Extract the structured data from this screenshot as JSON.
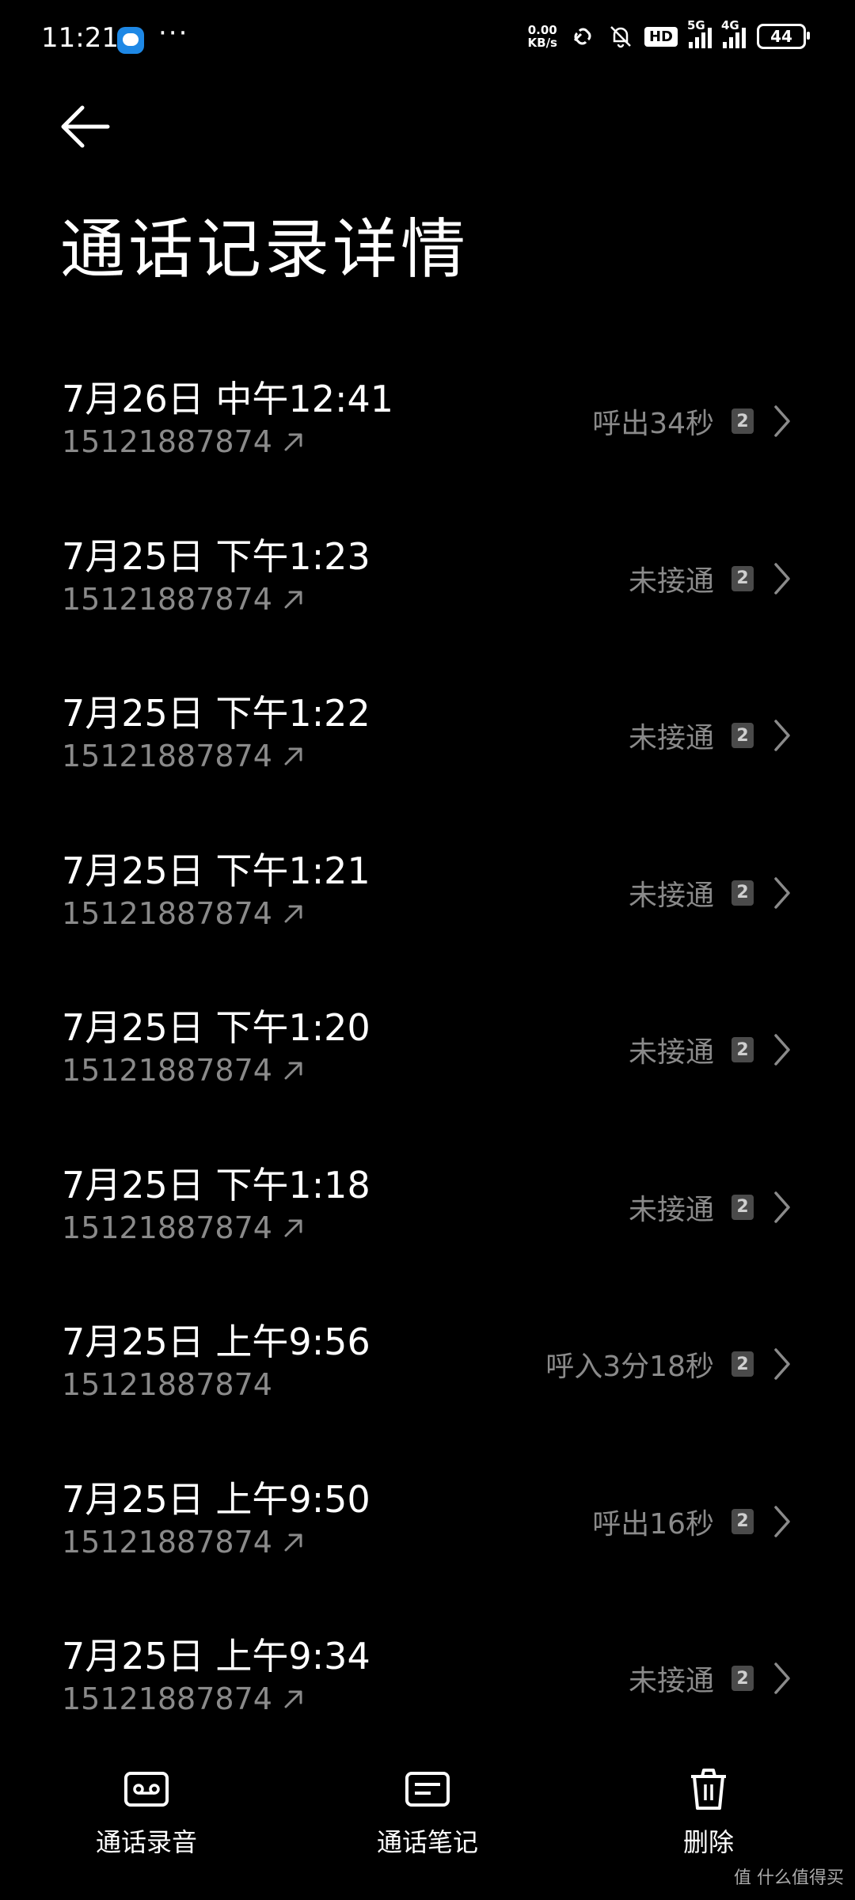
{
  "status_bar": {
    "time": "11:21",
    "more": "···",
    "net_speed_value": "0.00",
    "net_speed_unit": "KB/s",
    "hd_label": "HD",
    "sim1_label": "5G",
    "sim2_label": "4G",
    "battery": "44"
  },
  "header": {
    "title": "通话记录详情"
  },
  "calls": [
    {
      "datetime": "7月26日 中午12:41",
      "number": "15121887874",
      "status": "呼出34秒",
      "sim": "2",
      "outgoing": true
    },
    {
      "datetime": "7月25日 下午1:23",
      "number": "15121887874",
      "status": "未接通",
      "sim": "2",
      "outgoing": true
    },
    {
      "datetime": "7月25日 下午1:22",
      "number": "15121887874",
      "status": "未接通",
      "sim": "2",
      "outgoing": true
    },
    {
      "datetime": "7月25日 下午1:21",
      "number": "15121887874",
      "status": "未接通",
      "sim": "2",
      "outgoing": true
    },
    {
      "datetime": "7月25日 下午1:20",
      "number": "15121887874",
      "status": "未接通",
      "sim": "2",
      "outgoing": true
    },
    {
      "datetime": "7月25日 下午1:18",
      "number": "15121887874",
      "status": "未接通",
      "sim": "2",
      "outgoing": true
    },
    {
      "datetime": "7月25日 上午9:56",
      "number": "15121887874",
      "status": "呼入3分18秒",
      "sim": "2",
      "outgoing": false
    },
    {
      "datetime": "7月25日 上午9:50",
      "number": "15121887874",
      "status": "呼出16秒",
      "sim": "2",
      "outgoing": true
    },
    {
      "datetime": "7月25日 上午9:34",
      "number": "15121887874",
      "status": "未接通",
      "sim": "2",
      "outgoing": true
    }
  ],
  "bottom_bar": {
    "recording_label": "通话录音",
    "notes_label": "通话笔记",
    "delete_label": "删除"
  },
  "watermark": "值 什么值得买"
}
